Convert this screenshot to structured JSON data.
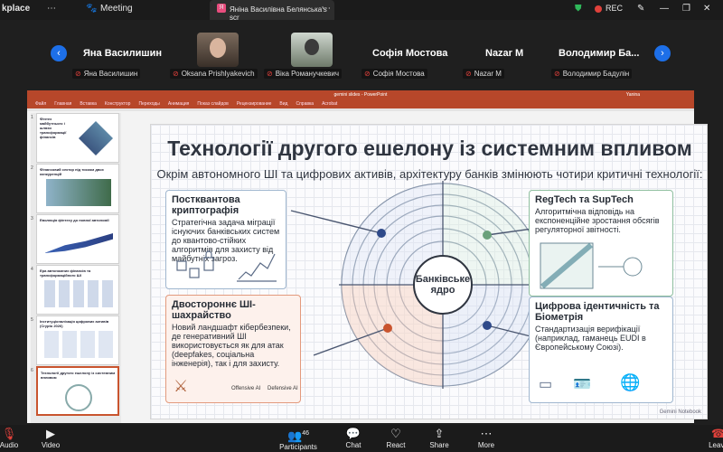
{
  "topbar": {
    "app_name": "kplace",
    "meeting_label": "Meeting",
    "share_tab": "Янiна Василiвна Белянська's scr",
    "rec_label": "REC"
  },
  "participants": {
    "tiles": [
      {
        "name": "Яна Василишин",
        "label": "Яна Василишин"
      },
      {
        "name": "",
        "label": "Oksana Prishlyakevich"
      },
      {
        "name": "",
        "label": "Віка Романучкевич"
      },
      {
        "name": "Софія Мостова",
        "label": "Софія Мостова"
      },
      {
        "name": "Nazar M",
        "label": "Nazar M"
      },
      {
        "name": "Володимир Ба...",
        "label": "Володимир Бадулін"
      }
    ]
  },
  "ppt": {
    "title": "gemini slides - PowerPoint",
    "user": "Yanina",
    "ribbon": [
      "Файл",
      "Главная",
      "Вставка",
      "Конструктор",
      "Переходы",
      "Анимация",
      "Показ слайдов",
      "Рецензирование",
      "Вид",
      "Справка",
      "Acrobat"
    ],
    "thumbs": [
      {
        "num": "1",
        "title": "Фінтех майбутнього і шляхи трансформації фінансів"
      },
      {
        "num": "2",
        "title": "Фінансовий сектор під тиском двох конкуренцій"
      },
      {
        "num": "3",
        "title": "Еволюція фінтеху до повної автономії"
      },
      {
        "num": "4",
        "title": "Ера автономних фінансів та трансформаційного ШІ"
      },
      {
        "num": "5",
        "title": "Інституціоналізація цифрових активів (Crypto 2026)"
      },
      {
        "num": "6",
        "title": "Технології другого ешелону із системним впливом"
      }
    ]
  },
  "slide": {
    "title": "Технології другого ешелону із системним впливом",
    "subtitle": "Окрім автономного ШІ та цифрових активів, архітектуру банків змінюють чотири критичні технології:",
    "core": "Банківське ядро",
    "cards": {
      "pqc": {
        "title": "Постквантова криптографія",
        "text": "Стратегічна задача міграції існуючих банківських систем до квантово-стійких алгоритмів для захисту від майбутніх загроз."
      },
      "regtech": {
        "title": "RegTech та SupTech",
        "text": "Алгоритмічна відповідь на експоненційне зростання обсягів регуляторної звітності."
      },
      "ai": {
        "title": "Двостороннє ШІ-шахрайство",
        "text": "Новий ландшафт кібербезпеки, де генеративний ШІ використовується як для атак (deepfakes, соціальна інженерія), так і для захисту.",
        "offensive": "Offensive AI",
        "defensive": "Defensive AI"
      },
      "identity": {
        "title": "Цифрова ідентичність та Біометрія",
        "text": "Стандартизація верифікації (наприклад, гаманець EUDI в Європейському Союзі)."
      }
    },
    "watermark": "Gemini Notebook"
  },
  "toolbar": {
    "audio": "Audio",
    "video": "Video",
    "participants": "Participants",
    "participants_count": "46",
    "chat": "Chat",
    "react": "React",
    "share": "Share",
    "more": "More",
    "leave": "Leave"
  }
}
